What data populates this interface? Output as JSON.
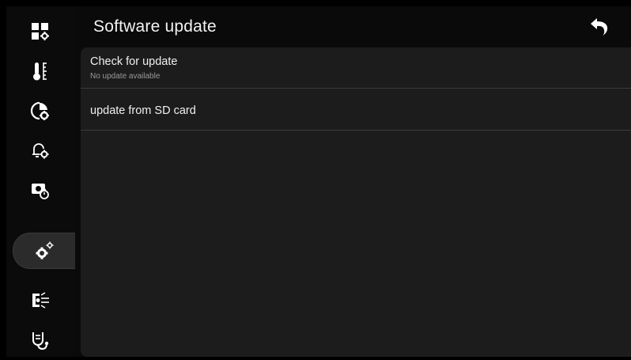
{
  "header": {
    "title": "Software update",
    "back_icon": "back-arrow-icon"
  },
  "sidebar": {
    "items": [
      {
        "icon": "display-settings-icon",
        "active": false
      },
      {
        "icon": "thermometer-icon",
        "active": false
      },
      {
        "icon": "timer-settings-icon",
        "active": false
      },
      {
        "icon": "alarm-settings-icon",
        "active": false
      },
      {
        "icon": "camera-timer-icon",
        "active": false
      },
      {
        "icon": "system-settings-gears-icon",
        "active": true
      },
      {
        "icon": "scan-icon",
        "active": false
      },
      {
        "icon": "stethoscope-icon",
        "active": false
      }
    ]
  },
  "main": {
    "items": [
      {
        "title": "Check for update",
        "subtitle": "No update available"
      },
      {
        "title": "update from SD card"
      }
    ]
  },
  "colors": {
    "background": "#000000",
    "panel": "#1c1c1c",
    "divider": "#3b3b3b",
    "active_tab": "#2b2b2b",
    "text": "#ffffff",
    "subtext": "#9a9a9a"
  }
}
